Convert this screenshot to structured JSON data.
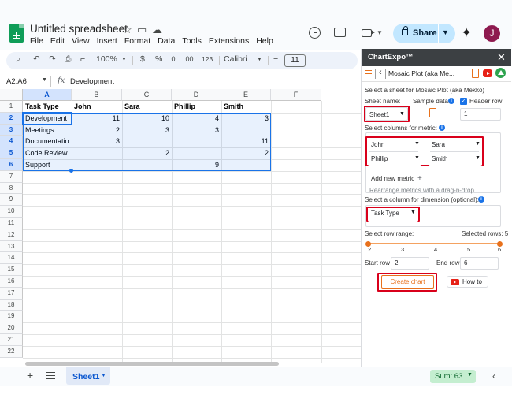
{
  "app": {
    "doc_title": "Untitled spreadsheet",
    "menu": [
      "File",
      "Edit",
      "View",
      "Insert",
      "Format",
      "Data",
      "Tools",
      "Extensions",
      "Help"
    ],
    "share_label": "Share",
    "avatar_initial": "J",
    "brand_color": "#0f9d58"
  },
  "toolbar": {
    "zoom": "100%",
    "currency": "$",
    "percent": "%",
    "decrease_decimals": ".0",
    "increase_decimals": ".00",
    "number_format": "123",
    "font": "Calibri",
    "font_size": "11"
  },
  "formula_bar": {
    "cell_ref": "A2:A6",
    "fx": "fx",
    "content": "Development"
  },
  "grid": {
    "columns": [
      "A",
      "B",
      "C",
      "D",
      "E",
      "F"
    ],
    "rows": [
      "1",
      "2",
      "3",
      "4",
      "5",
      "6",
      "7",
      "8",
      "9",
      "10",
      "11",
      "12",
      "13",
      "14",
      "15",
      "16",
      "17",
      "18",
      "19",
      "20",
      "21",
      "22"
    ],
    "header": [
      "Task Type",
      "John",
      "Sara",
      "Phillip",
      "Smith"
    ],
    "data": [
      [
        "Development",
        "11",
        "10",
        "4",
        "3"
      ],
      [
        "Meetings",
        "2",
        "3",
        "3",
        ""
      ],
      [
        "Documentation",
        "3",
        "",
        "",
        "11"
      ],
      [
        "Code Review",
        "",
        "2",
        "",
        "2"
      ],
      [
        "Support",
        "",
        "",
        "9",
        ""
      ]
    ]
  },
  "bottom": {
    "sheet_tab": "Sheet1",
    "sum": "Sum: 63"
  },
  "panel": {
    "title": "ChartExpo™",
    "plugin_name": "Mosaic Plot (aka Me...",
    "select_sheet_label": "Select a sheet for Mosaic Plot (aka Mekko)",
    "sheet_name_label": "Sheet name:",
    "sample_data_label": "Sample data:",
    "header_row_label": "Header row:",
    "sheet_value": "Sheet1",
    "header_row_value": "1",
    "select_metric_label": "Select columns for metric:",
    "metrics": [
      "John",
      "Sara",
      "Phillip",
      "Smith"
    ],
    "add_metric": "Add new metric",
    "add_plus": "+",
    "rearrange_hint": "Rearrange metrics with a drag-n-drop.",
    "select_dimension_label": "Select a column for dimension (optional):",
    "dimension_value": "Task Type",
    "row_range_label": "Select row range:",
    "selected_rows_label": "Selected rows: 5",
    "range_ticks": [
      "2",
      "3",
      "4",
      "5",
      "6"
    ],
    "selected_rows": 5,
    "range_min": 2,
    "range_max": 6,
    "start_row_label": "Start row",
    "start_row_value": "2",
    "end_row_label": "End row",
    "end_row_value": "6",
    "create_chart": "Create chart",
    "how_to": "How to",
    "accent_color": "#e8711c",
    "highlight_color": "#d9001b"
  }
}
